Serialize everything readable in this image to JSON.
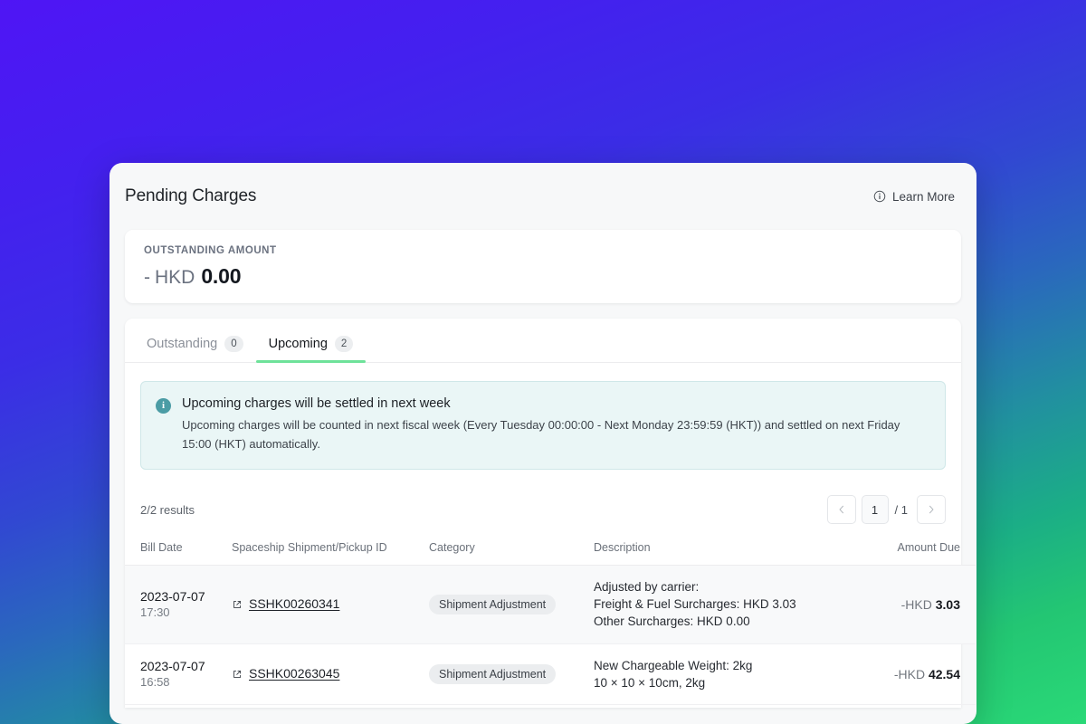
{
  "header": {
    "title": "Pending Charges",
    "learn_more_label": "Learn More",
    "learn_more_icon": "info-circle-icon"
  },
  "outstanding": {
    "label": "OUTSTANDING AMOUNT",
    "sign": "-",
    "currency": "HKD",
    "value": "0.00"
  },
  "tabs": [
    {
      "label": "Outstanding",
      "count": "0",
      "active": false
    },
    {
      "label": "Upcoming",
      "count": "2",
      "active": true
    }
  ],
  "banner": {
    "icon": "info-icon",
    "icon_glyph": "i",
    "title": "Upcoming charges will be settled in next week",
    "text": "Upcoming charges will be counted in next fiscal week (Every Tuesday 00:00:00 - Next Monday 23:59:59 (HKT)) and settled on next Friday 15:00 (HKT) automatically."
  },
  "results": {
    "count_label": "2/2 results",
    "pager": {
      "prev_icon": "chevron-left-icon",
      "next_icon": "chevron-right-icon",
      "current_page": "1",
      "total_pages": "/ 1"
    }
  },
  "table": {
    "columns": [
      "Bill Date",
      "Spaceship Shipment/Pickup ID",
      "Category",
      "Description",
      "Amount Due"
    ],
    "rows": [
      {
        "date": "2023-07-07",
        "time": "17:30",
        "shipment_id": "SSHK00260341",
        "link_icon": "external-link-icon",
        "category": "Shipment Adjustment",
        "description_lines": [
          "Adjusted by carrier:",
          "Freight & Fuel Surcharges: HKD 3.03",
          "Other Surcharges: HKD 0.00"
        ],
        "amount_currency": "-HKD",
        "amount_value": "3.03"
      },
      {
        "date": "2023-07-07",
        "time": "16:58",
        "shipment_id": "SSHK00263045",
        "link_icon": "external-link-icon",
        "category": "Shipment Adjustment",
        "description_lines": [
          "New Chargeable Weight: 2kg",
          "10 × 10 × 10cm, 2kg"
        ],
        "amount_currency": "-HKD",
        "amount_value": "42.54"
      }
    ]
  },
  "colors": {
    "accent_green": "#6ee29a",
    "banner_bg": "#eaf6f6",
    "banner_icon": "#4b9ca5",
    "gradient_start": "#4f15f5",
    "gradient_end": "#2ad977"
  }
}
